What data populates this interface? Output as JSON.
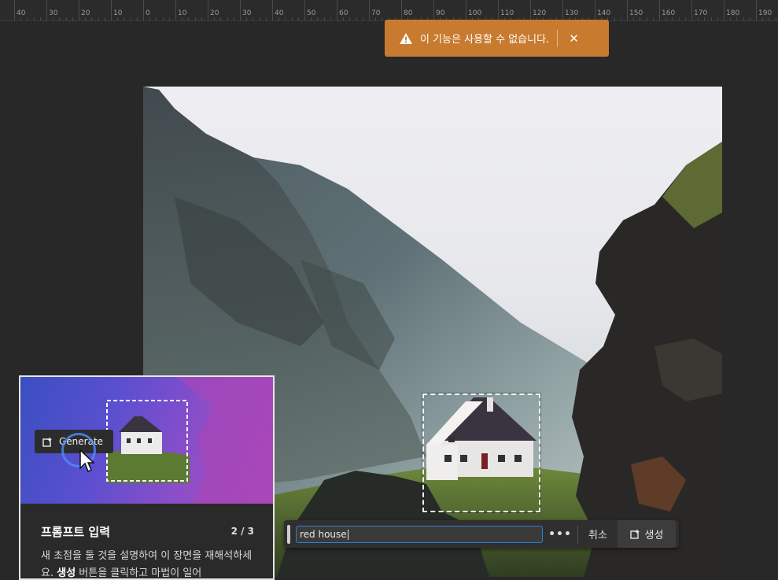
{
  "ruler": {
    "labels": [
      "40",
      "30",
      "20",
      "10",
      "0",
      "10",
      "20",
      "30",
      "40",
      "50",
      "60",
      "70",
      "80",
      "90",
      "100",
      "110",
      "120",
      "130",
      "140",
      "150",
      "160",
      "170",
      "180",
      "190"
    ]
  },
  "toast": {
    "icon": "warning-icon",
    "message": "이 기능은 사용할 수 없습니다.",
    "close_label": "✕",
    "color": "#c87a2f"
  },
  "prompt_bar": {
    "input_value": "red house",
    "more_label": "•••",
    "cancel_label": "취소",
    "generate_label": "생성",
    "generate_icon": "generative-fill-icon"
  },
  "tutorial_card": {
    "chip_label": "Generate",
    "chip_icon": "generative-fill-icon",
    "title": "프롬프트 입력",
    "step": "2 / 3",
    "body_part1": "새 초점을 둘 것을 설명하여 이 장면을 재해석하세요. ",
    "body_bold": "생성",
    "body_part2": " 버튼을 클릭하고 마법이 일어"
  }
}
